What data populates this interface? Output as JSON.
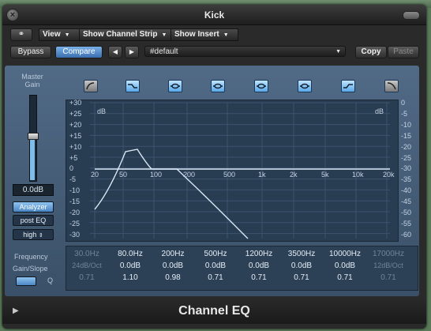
{
  "window": {
    "title": "Kick"
  },
  "toolbar": {
    "view_label": "View",
    "show_channel_strip_label": "Show Channel Strip",
    "show_insert_label": "Show Insert",
    "bypass_label": "Bypass",
    "compare_label": "Compare",
    "prev_label": "◀",
    "next_label": "▶",
    "preset_value": "#default",
    "copy_label": "Copy",
    "paste_label": "Paste"
  },
  "side": {
    "master_gain_label": "Master Gain",
    "gain_value": "0.0dB",
    "master_gain_level_db": 0.0,
    "analyzer_label": "Analyzer",
    "post_eq_label": "post EQ",
    "resolution_label": "high"
  },
  "graph": {
    "left_unit": "dB",
    "right_unit": "dB",
    "left_ticks": [
      "+30",
      "+25",
      "+20",
      "+15",
      "+10",
      "+5",
      "0",
      "-5",
      "-10",
      "-15",
      "-20",
      "-25",
      "-30"
    ],
    "right_ticks": [
      "0",
      "-5",
      "-10",
      "-15",
      "-20",
      "-25",
      "-30",
      "-35",
      "-40",
      "-45",
      "-50",
      "-55",
      "-60"
    ],
    "freq_ticks": [
      "20",
      "50",
      "100",
      "200",
      "500",
      "1k",
      "2k",
      "5k",
      "10k",
      "20k"
    ]
  },
  "bands": {
    "row_labels": {
      "frequency": "Frequency",
      "gain_slope": "Gain/Slope",
      "q": "Q"
    },
    "frequency": [
      "30.0Hz",
      "80.0Hz",
      "200Hz",
      "500Hz",
      "1200Hz",
      "3500Hz",
      "10000Hz",
      "17000Hz"
    ],
    "gain": [
      "24dB/Oct",
      "0.0dB",
      "0.0dB",
      "0.0dB",
      "0.0dB",
      "0.0dB",
      "0.0dB",
      "12dB/Oct"
    ],
    "q": [
      "0.71",
      "1.10",
      "0.98",
      "0.71",
      "0.71",
      "0.71",
      "0.71",
      "0.71"
    ]
  },
  "footer": {
    "plugin_name": "Channel EQ"
  },
  "colors": {
    "accent": "#5aa8e8",
    "panel": "#455d78",
    "curve": "#d8e8f4"
  }
}
